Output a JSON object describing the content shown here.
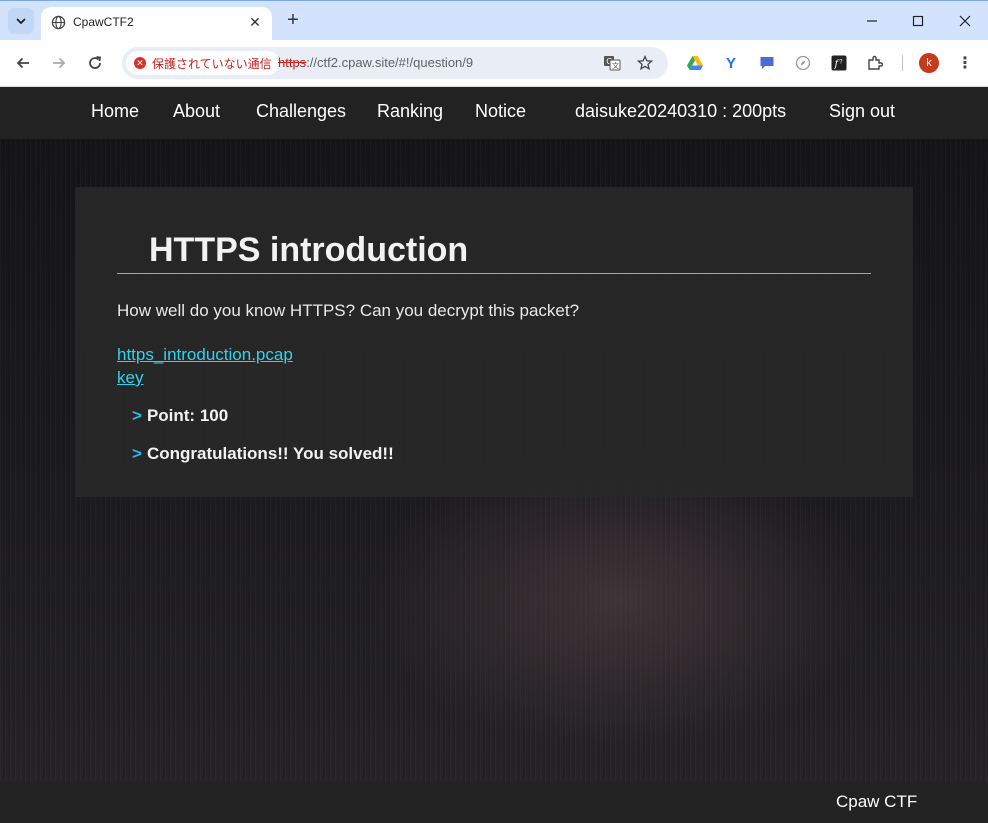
{
  "browser": {
    "tab_title": "CpawCTF2",
    "tab_close_glyph": "✕",
    "new_tab_glyph": "+",
    "security_label": "保護されていない通信",
    "url_scheme": "https",
    "url_rest": "://ctf2.cpaw.site/#!/question/9",
    "profile_initial": "k",
    "extension_v_glyph": "Y",
    "icons": [
      "tab-search-icon",
      "globe-icon",
      "close-icon",
      "plus-icon",
      "minimize-icon",
      "maximize-icon",
      "window-close-icon",
      "back-arrow-icon",
      "forward-arrow-icon",
      "reload-icon",
      "warning-icon",
      "translate-icon",
      "star-icon",
      "drive-icon",
      "chat-icon",
      "compass-icon",
      "f-icon",
      "puzzle-icon",
      "kebab-menu-icon"
    ]
  },
  "nav": {
    "home": "Home",
    "about": "About",
    "challenges": "Challenges",
    "ranking": "Ranking",
    "notice": "Notice",
    "user": "daisuke20240310 : 200pts",
    "signout": "Sign out"
  },
  "question": {
    "title": "HTTPS introduction",
    "description": "How well do you know HTTPS? Can you decrypt this packet?",
    "files": [
      "https_introduction.pcap",
      "key"
    ],
    "caret": ">",
    "point_text": "Point: 100",
    "solved_text": "Congratulations!! You solved!!"
  },
  "footer": {
    "text": "Cpaw CTF"
  },
  "colors": {
    "tabstrip": "#d3e3fd",
    "nav_bg": "#222222",
    "title_rule": "#5bc0de",
    "link": "#2fd3f0",
    "caret": "#2fb4f0",
    "security_red": "#c5221f"
  }
}
